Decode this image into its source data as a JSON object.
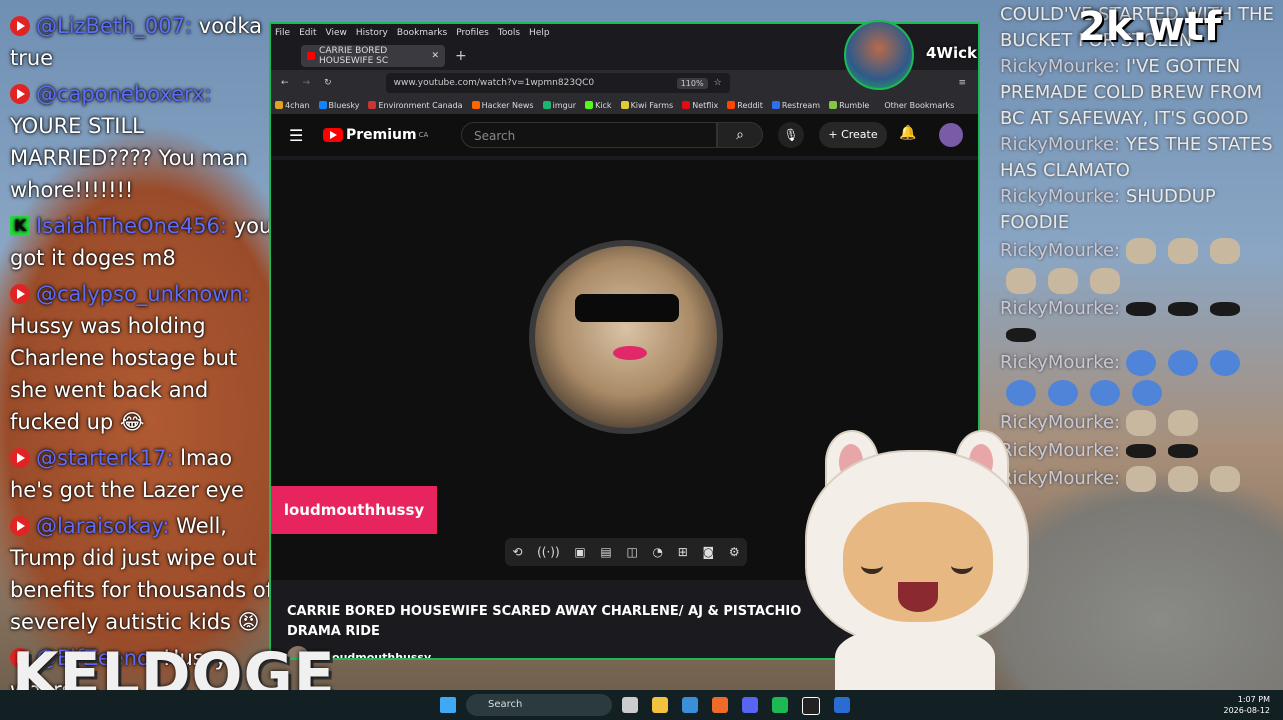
{
  "overlay": {
    "brand_text": "2k.wtf",
    "streamer_watermark": "KELDOGE",
    "top_avatar_name": "4Wick"
  },
  "chat_left": [
    {
      "platform": "youtube",
      "user": "@LizBeth_007:",
      "text": "vodka true"
    },
    {
      "platform": "youtube",
      "user": "@caponeboxerx:",
      "text": "YOURE STILL MARRIED???? You man whore!!!!!!!"
    },
    {
      "platform": "kick",
      "user": "IsaiahTheOne456:",
      "text": "you got it doges m8"
    },
    {
      "platform": "youtube",
      "user": "@calypso_unknown:",
      "text": "Hussy was holding Charlene hostage but she went back and fucked up 😂"
    },
    {
      "platform": "youtube",
      "user": "@starterk17:",
      "text": "lmao he's got the Lazer eye"
    },
    {
      "platform": "youtube",
      "user": "@laraisokay:",
      "text": "Well, Trump did just wipe out benefits for thousands of severely autistic kids 😡"
    },
    {
      "platform": "youtube",
      "user": "@ElfZeeno:",
      "text": "Hussy wears"
    }
  ],
  "chat_right": [
    {
      "user": "",
      "text": "COULD'VE STARTED WITH THE BUCKET FOR STOLEN"
    },
    {
      "user": "RickyMourke:",
      "text": "I'VE GOTTEN PREMADE COLD BREW FROM BC AT SAFEWAY, IT'S GOOD"
    },
    {
      "user": "RickyMourke:",
      "text": "YES THE STATES HAS CLAMATO"
    },
    {
      "user": "RickyMourke:",
      "text": "SHUDDUP FOODIE"
    },
    {
      "user": "RickyMourke:",
      "text": ""
    },
    {
      "user": "RickyMourke:",
      "text": ""
    },
    {
      "user": "RickyMourke:",
      "text": ""
    },
    {
      "user": "RickyMourke:",
      "text": ""
    },
    {
      "user": "RickyMourke:",
      "text": ""
    },
    {
      "user": "RickyMourke:",
      "text": ""
    }
  ],
  "browser": {
    "menu": [
      "File",
      "Edit",
      "View",
      "History",
      "Bookmarks",
      "Profiles",
      "Tools",
      "Help"
    ],
    "tab_title": "CARRIE BORED HOUSEWIFE SC",
    "url": "www.youtube.com/watch?v=1wpmn823QC0",
    "zoom": "110%",
    "bookmarks": [
      "4chan",
      "Bluesky",
      "Environment Canada",
      "Hacker News",
      "imgur",
      "Kick",
      "Kiwi Farms",
      "Netflix",
      "Reddit",
      "Restream",
      "Rumble"
    ],
    "other_bookmarks": "Other Bookmarks"
  },
  "youtube": {
    "logo_text": "Premium",
    "region": "CA",
    "search_placeholder": "Search",
    "create_label": "Create",
    "name_badge": "loudmouthhussy",
    "video_title": "CARRIE BORED HOUSEWIFE SCARED AWAY CHARLENE/ AJ & PISTACHIO DRAMA RIDE",
    "channel_name": "Loudmouthhussy"
  },
  "taskbar": {
    "search_label": "Search",
    "time": "1:07 PM",
    "date": "2026-08-12"
  },
  "colors": {
    "accent": "#1db954",
    "youtube_red": "#ff0000",
    "badge_pink": "#e8245e",
    "chat_user": "#5f6df5"
  }
}
